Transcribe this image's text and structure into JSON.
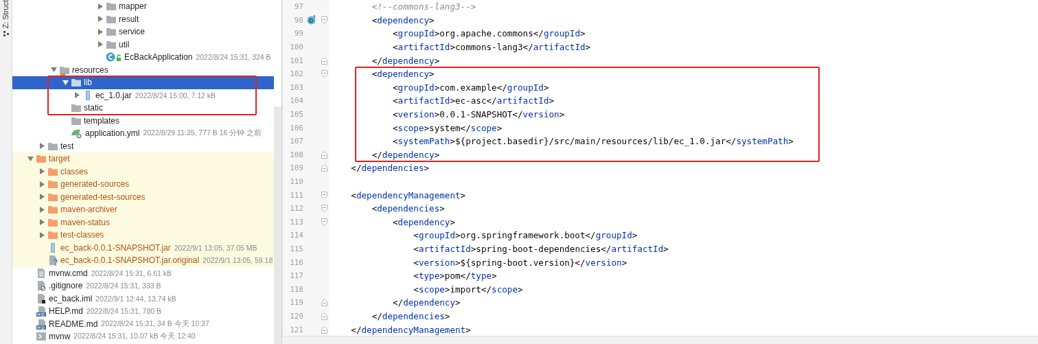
{
  "side_strip": {
    "tab": "Z: Struct"
  },
  "tree": [
    {
      "children": [
        {
          "children": [
            {
              "children": [
                {
                  "children": [
                    {
                      "children": [
                        {
                          "children": [
                            {
                              "label": "mapper",
                              "kind": "folder",
                              "expanded": false,
                              "selected": false,
                              "excluded": false
                            },
                            {
                              "label": "result",
                              "kind": "folder",
                              "expanded": false,
                              "selected": false,
                              "excluded": false
                            },
                            {
                              "label": "service",
                              "kind": "folder",
                              "expanded": false,
                              "selected": false,
                              "excluded": false
                            },
                            {
                              "label": "util",
                              "kind": "folder",
                              "expanded": false,
                              "selected": false,
                              "excluded": false
                            },
                            {
                              "label": "EcBackApplication",
                              "info": "2022/8/24 15:31, 324 B",
                              "kind": "java-class",
                              "selected": false,
                              "excluded": false
                            }
                          ]
                        }
                      ]
                    }
                  ]
                }
              ]
            },
            {
              "label": "resources",
              "kind": "resources-folder",
              "expanded": true,
              "selected": false,
              "excluded": false,
              "children": [
                {
                  "label": "lib",
                  "kind": "folder",
                  "expanded": true,
                  "selected": true,
                  "excluded": false,
                  "children": [
                    {
                      "label": "ec_1.0.jar",
                      "info": "2022/8/24 15:00, 7.12 kB",
                      "kind": "jar",
                      "expanded": false,
                      "selected": false,
                      "excluded": false
                    }
                  ]
                },
                {
                  "label": "static",
                  "kind": "folder",
                  "selected": false,
                  "excluded": false
                },
                {
                  "label": "templates",
                  "kind": "folder",
                  "selected": false,
                  "excluded": false
                },
                {
                  "label": "application.yml",
                  "info": "2022/8/29 11:35, 777 B 16 分钟 之前",
                  "kind": "yml",
                  "selected": false,
                  "excluded": false
                }
              ]
            }
          ]
        },
        {
          "label": "test",
          "kind": "folder",
          "expanded": false,
          "selected": false,
          "excluded": false
        }
      ]
    },
    {
      "label": "target",
      "kind": "folder",
      "expanded": true,
      "selected": false,
      "excluded": true,
      "children": [
        {
          "label": "classes",
          "kind": "folder",
          "expanded": false,
          "selected": false,
          "excluded": true
        },
        {
          "label": "generated-sources",
          "kind": "folder",
          "expanded": false,
          "selected": false,
          "excluded": true
        },
        {
          "label": "generated-test-sources",
          "kind": "folder",
          "expanded": false,
          "selected": false,
          "excluded": true
        },
        {
          "label": "maven-archiver",
          "kind": "folder",
          "expanded": false,
          "selected": false,
          "excluded": true
        },
        {
          "label": "maven-status",
          "kind": "folder",
          "expanded": false,
          "selected": false,
          "excluded": true
        },
        {
          "label": "test-classes",
          "kind": "folder",
          "expanded": false,
          "selected": false,
          "excluded": true
        },
        {
          "label": "ec_back-0.0.1-SNAPSHOT.jar",
          "info": "2022/9/1 13:05, 37.05 MB",
          "kind": "jar",
          "selected": false,
          "excluded": true
        },
        {
          "label": "ec_back-0.0.1-SNAPSHOT.jar.original",
          "info": "2022/9/1 13:05, 59.18",
          "kind": "unknown-file",
          "selected": false,
          "excluded": true
        }
      ]
    },
    {
      "label": "mvnw.cmd",
      "info": "2022/8/24 15:31, 6.61 kB",
      "kind": "text-file",
      "selected": false,
      "excluded": false
    },
    {
      "label": ".gitignore",
      "info": "2022/8/24 15:31, 333 B",
      "kind": "ignore-file",
      "selected": false,
      "excluded": false
    },
    {
      "label": "ec_back.iml",
      "info": "2022/9/1 12:44, 13.74 kB",
      "kind": "module-file",
      "selected": false,
      "excluded": false
    },
    {
      "label": "HELP.md",
      "info": "2022/8/24 15:31, 780 B",
      "kind": "markdown",
      "selected": false,
      "excluded": false
    },
    {
      "label": "README.md",
      "info": "2022/8/24 15:31, 34 B 今天 10:37",
      "kind": "markdown",
      "selected": false,
      "excluded": false
    },
    {
      "label": "mvnw",
      "info": "2022/8/24 15:31, 10.07 kB 今天 12:40",
      "kind": "script",
      "selected": false,
      "excluded": false
    }
  ],
  "editor": {
    "lines": [
      {
        "number": "97",
        "kind": "comment",
        "text": "        <!--commons-lang3-->"
      },
      {
        "number": "98",
        "kind": "code",
        "text": "        <dependency>",
        "fold_start": true,
        "marker": true
      },
      {
        "number": "99",
        "kind": "code",
        "text": "            <groupId>org.apache.commons</groupId>"
      },
      {
        "number": "100",
        "kind": "code",
        "text": "            <artifactId>commons-lang3</artifactId>"
      },
      {
        "number": "101",
        "kind": "code",
        "text": "        </dependency>",
        "fold_end": true
      },
      {
        "number": "102",
        "kind": "code",
        "text": "        <dependency>",
        "fold_start": true
      },
      {
        "number": "103",
        "kind": "code",
        "text": "            <groupId>com.example</groupId>"
      },
      {
        "number": "104",
        "kind": "code",
        "text": "            <artifactId>ec-asc</artifactId>"
      },
      {
        "number": "105",
        "kind": "code",
        "text": "            <version>0.0.1-SNAPSHOT</version>"
      },
      {
        "number": "106",
        "kind": "code",
        "text": "            <scope>system</scope>"
      },
      {
        "number": "107",
        "kind": "code",
        "text": "            <systemPath>${project.basedir}/src/main/resources/lib/ec_1.0.jar</systemPath>"
      },
      {
        "number": "108",
        "kind": "code",
        "text": "        </dependency>",
        "fold_end": true
      },
      {
        "number": "109",
        "kind": "code",
        "text": "    </dependencies>",
        "fold_end": true
      },
      {
        "number": "110",
        "kind": "blank"
      },
      {
        "number": "111",
        "kind": "code",
        "text": "    <dependencyManagement>",
        "fold_start": true
      },
      {
        "number": "112",
        "kind": "code",
        "text": "        <dependencies>",
        "fold_start": true
      },
      {
        "number": "113",
        "kind": "code",
        "text": "            <dependency>",
        "fold_start": true
      },
      {
        "number": "114",
        "kind": "code",
        "text": "                <groupId>org.springframework.boot</groupId>"
      },
      {
        "number": "115",
        "kind": "code",
        "text": "                <artifactId>spring-boot-dependencies</artifactId>"
      },
      {
        "number": "116",
        "kind": "code",
        "text": "                <version>${spring-boot.version}</version>"
      },
      {
        "number": "117",
        "kind": "code",
        "text": "                <type>pom</type>"
      },
      {
        "number": "118",
        "kind": "code",
        "text": "                <scope>import</scope>"
      },
      {
        "number": "119",
        "kind": "code",
        "text": "            </dependency>",
        "fold_end": true
      },
      {
        "number": "120",
        "kind": "code",
        "text": "        </dependencies>",
        "fold_end": true
      },
      {
        "number": "121",
        "kind": "code",
        "text": "    </dependencyManagement>",
        "fold_end": true
      }
    ]
  }
}
